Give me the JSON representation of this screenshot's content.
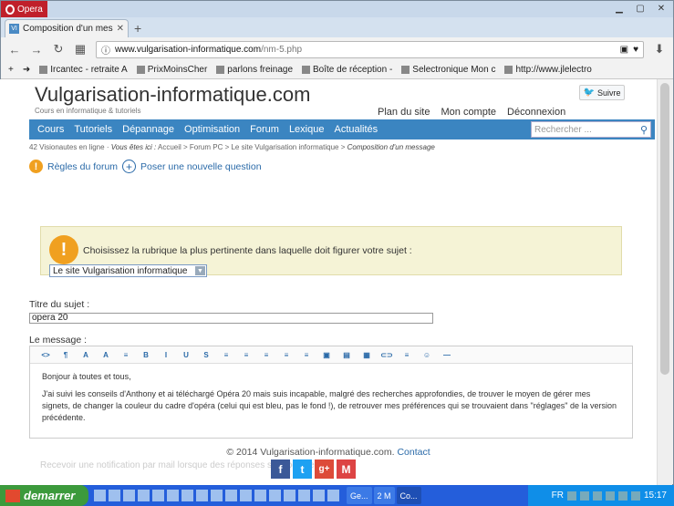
{
  "browser": {
    "title_button": "Opera",
    "tab_title": "Composition d'un message",
    "url_domain": "www.vulgarisation-informatique.com",
    "url_path": "/nm-5.php",
    "bookmarks": [
      "Ircantec - retraite A",
      "PrixMoinsCher",
      "parlons freinage",
      "Boîte de réception -",
      "Selectronique Mon c",
      "http://www.jlelectro"
    ]
  },
  "site": {
    "logo": "Vulgarisation-informatique.com",
    "tagline": "Cours en informatique & tutoriels",
    "top_links": [
      "Plan du site",
      "Mon compte",
      "Déconnexion"
    ],
    "twitter_label": "Suivre",
    "menu": [
      "Cours",
      "Tutoriels",
      "Dépannage",
      "Optimisation",
      "Forum",
      "Lexique",
      "Actualités"
    ],
    "search_placeholder": "Rechercher ..."
  },
  "breadcrumb": {
    "online": "42 Visionautes en ligne",
    "you_are": "Vous êtes ici :",
    "path": "Accueil > Forum PC > Le site Vulgarisation informatique >",
    "current": "Composition d'un message"
  },
  "actions": {
    "rules": "Règles du forum",
    "new_question": "Poser une nouvelle question"
  },
  "notice": {
    "text": "Choisissez la rubrique la plus pertinente dans laquelle doit figurer votre sujet :",
    "selected_category": "Le site Vulgarisation informatique"
  },
  "form": {
    "subject_label": "Titre du sujet :",
    "subject_value": "opera 20",
    "message_label": "Le message :",
    "toolbar": [
      "<>",
      "¶",
      "A",
      "A",
      "≡",
      "B",
      "I",
      "U",
      "S",
      "≡",
      "≡",
      "≡",
      "≡",
      "≡",
      "▣",
      "▤",
      "▦",
      "⊂⊃",
      "≡",
      "☺",
      "—"
    ],
    "message_lines": [
      "Bonjour à toutes et tous,",
      "J'ai suivi les conseils d'Anthony et ai téléchargé Opéra 20 mais suis incapable, malgré des recherches approfondies, de trouver le moyen de gérer mes signets, de changer la couleur du cadre d'opéra (celui qui est bleu, pas le fond !), de retrouver mes préférences qui se trouvaient dans \"réglages\" de la version précédente."
    ]
  },
  "footer": {
    "copyright": "© 2014 Vulgarisation-informatique.com.",
    "contact": "Contact",
    "ghost": "Recevoir une notification par mail lorsque des réponses sont postées"
  },
  "taskbar": {
    "start": "demarrer",
    "tasks": [
      "Ge...",
      "2 M",
      "Co..."
    ],
    "lang": "FR",
    "clock": "15:17"
  },
  "colors": {
    "menu_blue": "#3b85c1",
    "link_blue": "#2a6aa8",
    "notice_bg": "#f5f3d6",
    "warn_orange": "#f0a020"
  }
}
